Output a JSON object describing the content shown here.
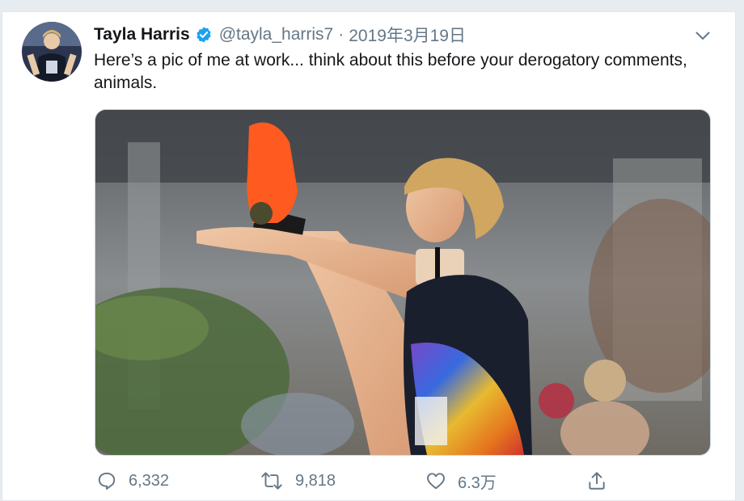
{
  "tweet": {
    "author_name": "Tayla Harris",
    "handle": "@tayla_harris7",
    "separator": "·",
    "date": "2019年3月19日",
    "text": "Here’s a pic of me at work... think about this before your derogatory comments, animals."
  },
  "actions": {
    "reply_count": "6,332",
    "retweet_count": "9,818",
    "like_count": "6.3万"
  },
  "icons": {
    "verified": "verified-badge-icon",
    "menu": "chevron-down-icon",
    "reply": "reply-icon",
    "retweet": "retweet-icon",
    "like": "heart-icon",
    "share": "share-icon"
  },
  "colors": {
    "verified_blue": "#1da1f2",
    "muted": "#657786",
    "text": "#14171a",
    "jersey_navy": "#1a1f2e",
    "boot_orange": "#ff5a1f"
  }
}
